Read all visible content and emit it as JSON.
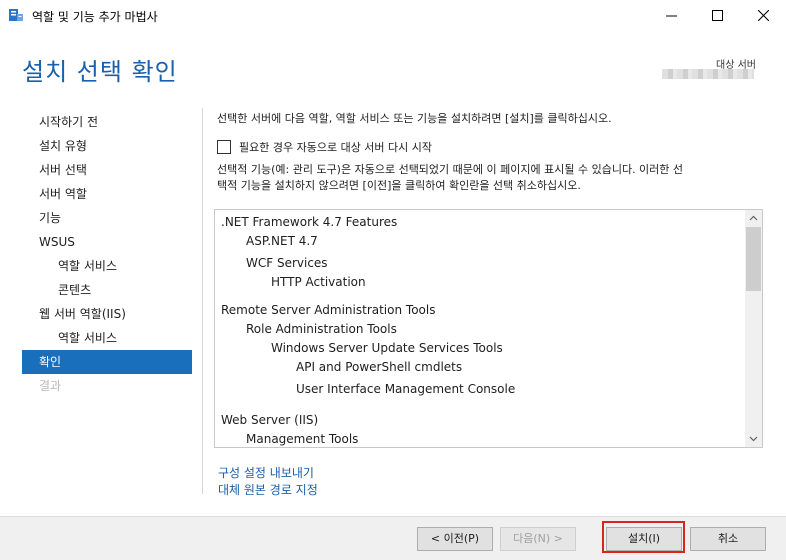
{
  "window": {
    "title": "역할 및 기능 추가 마법사"
  },
  "header": {
    "page_title": "설치 선택 확인",
    "target_server_label": "대상 서버"
  },
  "nav": {
    "items": [
      {
        "label": "시작하기 전",
        "state": "normal"
      },
      {
        "label": "설치 유형",
        "state": "normal"
      },
      {
        "label": "서버 선택",
        "state": "normal"
      },
      {
        "label": "서버 역할",
        "state": "normal"
      },
      {
        "label": "기능",
        "state": "normal"
      },
      {
        "label": "WSUS",
        "state": "normal"
      },
      {
        "label": "역할 서비스",
        "state": "sub"
      },
      {
        "label": "콘텐츠",
        "state": "sub"
      },
      {
        "label": "웹 서버 역할(IIS)",
        "state": "normal"
      },
      {
        "label": "역할 서비스",
        "state": "sub"
      },
      {
        "label": "확인",
        "state": "active"
      },
      {
        "label": "결과",
        "state": "disabled"
      }
    ]
  },
  "main": {
    "intro": "선택한 서버에 다음 역할, 역할 서비스 또는 기능을 설치하려면 [설치]를 클릭하십시오.",
    "restart_checkbox": {
      "label": "필요한 경우 자동으로 대상 서버 다시 시작",
      "checked": false
    },
    "note_line1": "선택적 기능(예: 관리 도구)은 자동으로 선택되었기 때문에 이 페이지에 표시될 수 있습니다. 이러한 선",
    "note_line2": "택적 기능을 설치하지 않으려면 [이전]을 클릭하여 확인란을 선택 취소하십시오.",
    "features": [
      {
        "label": ".NET Framework 4.7 Features",
        "level": 0
      },
      {
        "label": "ASP.NET 4.7",
        "level": 1
      },
      {
        "label": "WCF Services",
        "level": 1
      },
      {
        "label": "HTTP Activation",
        "level": 2
      },
      {
        "label": "Remote Server Administration Tools",
        "level": 0
      },
      {
        "label": "Role Administration Tools",
        "level": 1
      },
      {
        "label": "Windows Server Update Services Tools",
        "level": 2
      },
      {
        "label": "API and PowerShell cmdlets",
        "level": 3
      },
      {
        "label": "User Interface Management Console",
        "level": 3
      },
      {
        "label": "Web Server (IIS)",
        "level": 0
      },
      {
        "label": "Management Tools",
        "level": 1
      }
    ],
    "links": {
      "export": "구성 설정 내보내기",
      "alt_source": "대체 원본 경로 지정"
    }
  },
  "footer": {
    "prev": "< 이전(P)",
    "next": "다음(N) >",
    "install": "설치(I)",
    "cancel": "취소"
  },
  "colors": {
    "accent": "#1a6fbd",
    "title": "#1a5faa",
    "highlight": "#d9261c"
  }
}
